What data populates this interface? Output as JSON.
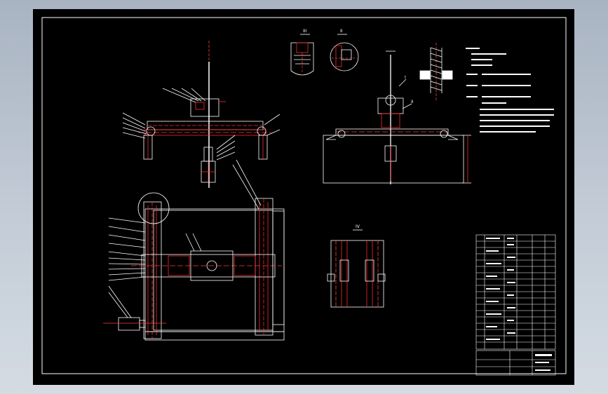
{
  "views": {
    "section_iii": "III",
    "section_ii": "II",
    "detail_i": "I",
    "detail_ii": "II",
    "detail_iv": "IV"
  },
  "colors": {
    "background": "#000000",
    "frame": "#ffffff",
    "part_lines": "#ff2a2a",
    "centerline": "#ff3b3b",
    "viewport": "#b9c3cf"
  }
}
